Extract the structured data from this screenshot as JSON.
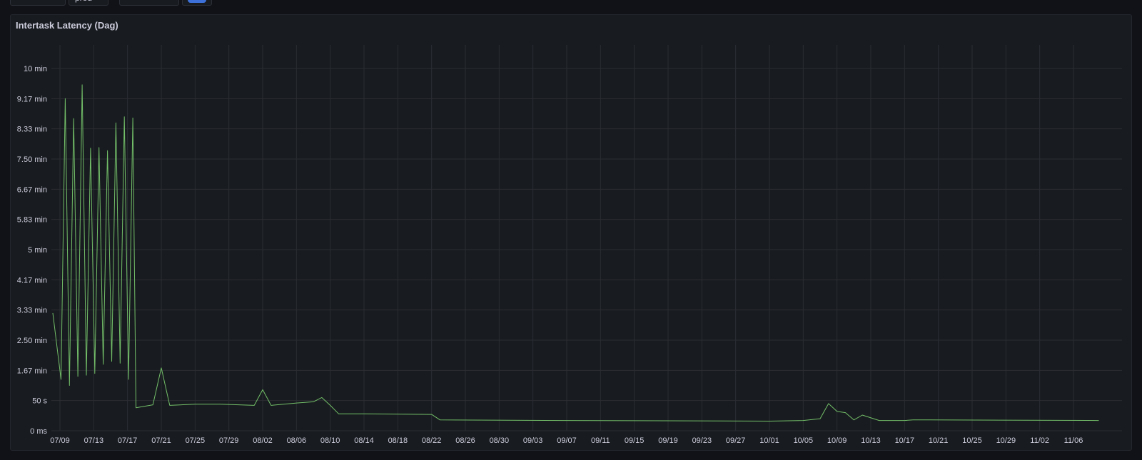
{
  "top_controls": {
    "env_value": "prod",
    "toggle_on": true
  },
  "panel": {
    "title": "Intertask Latency (Dag)"
  },
  "colors": {
    "series": "#73bf69",
    "grid": "#2a2d33",
    "background": "#181b1f"
  },
  "chart_data": {
    "type": "line",
    "title": "Intertask Latency (Dag)",
    "xlabel": "",
    "ylabel": "",
    "grid": true,
    "legend": "none",
    "y_ticks": [
      "0 ms",
      "50 s",
      "1.67 min",
      "2.50 min",
      "3.33 min",
      "4.17 min",
      "5 min",
      "5.83 min",
      "6.67 min",
      "7.50 min",
      "8.33 min",
      "9.17 min",
      "10 min"
    ],
    "y_tick_seconds": [
      0,
      50,
      100,
      150,
      200,
      250,
      300,
      350,
      400,
      450,
      500,
      550,
      600
    ],
    "ylim_seconds": [
      0,
      600
    ],
    "x_ticks": [
      "07/09",
      "07/13",
      "07/17",
      "07/21",
      "07/25",
      "07/29",
      "08/02",
      "08/06",
      "08/10",
      "08/14",
      "08/18",
      "08/22",
      "08/26",
      "08/30",
      "09/03",
      "09/07",
      "09/11",
      "09/15",
      "09/19",
      "09/23",
      "09/27",
      "10/01",
      "10/05",
      "10/09",
      "10/13",
      "10/17",
      "10/21",
      "10/25",
      "10/29",
      "11/02",
      "11/06"
    ],
    "xlim": [
      "07/09",
      "11/09"
    ],
    "series": [
      {
        "unit": "seconds",
        "x": [
          "07/08",
          "07/09",
          "07/09",
          "07/10",
          "07/10",
          "07/11",
          "07/11",
          "07/12",
          "07/12",
          "07/13",
          "07/13",
          "07/14",
          "07/14",
          "07/15",
          "07/15",
          "07/16",
          "07/16",
          "07/17",
          "07/17",
          "07/18",
          "07/20",
          "07/21",
          "07/22",
          "07/25",
          "07/28",
          "08/01",
          "08/02",
          "08/03",
          "08/06",
          "08/08",
          "08/09",
          "08/10",
          "08/11",
          "08/14",
          "08/22",
          "08/23",
          "09/07",
          "10/01",
          "10/05",
          "10/07",
          "10/08",
          "10/09",
          "10/10",
          "10/11",
          "10/12",
          "10/14",
          "10/17",
          "10/18",
          "10/20",
          "11/09"
        ],
        "y": [
          195,
          85,
          550,
          75,
          517,
          90,
          573,
          92,
          468,
          95,
          469,
          110,
          464,
          115,
          510,
          112,
          520,
          85,
          518,
          38,
          43,
          104,
          42,
          44,
          44,
          42,
          68,
          42,
          46,
          48,
          55,
          42,
          28,
          28,
          27,
          18,
          17,
          16,
          17,
          20,
          45,
          32,
          30,
          18,
          26,
          17,
          17,
          18,
          18,
          17
        ]
      }
    ]
  }
}
